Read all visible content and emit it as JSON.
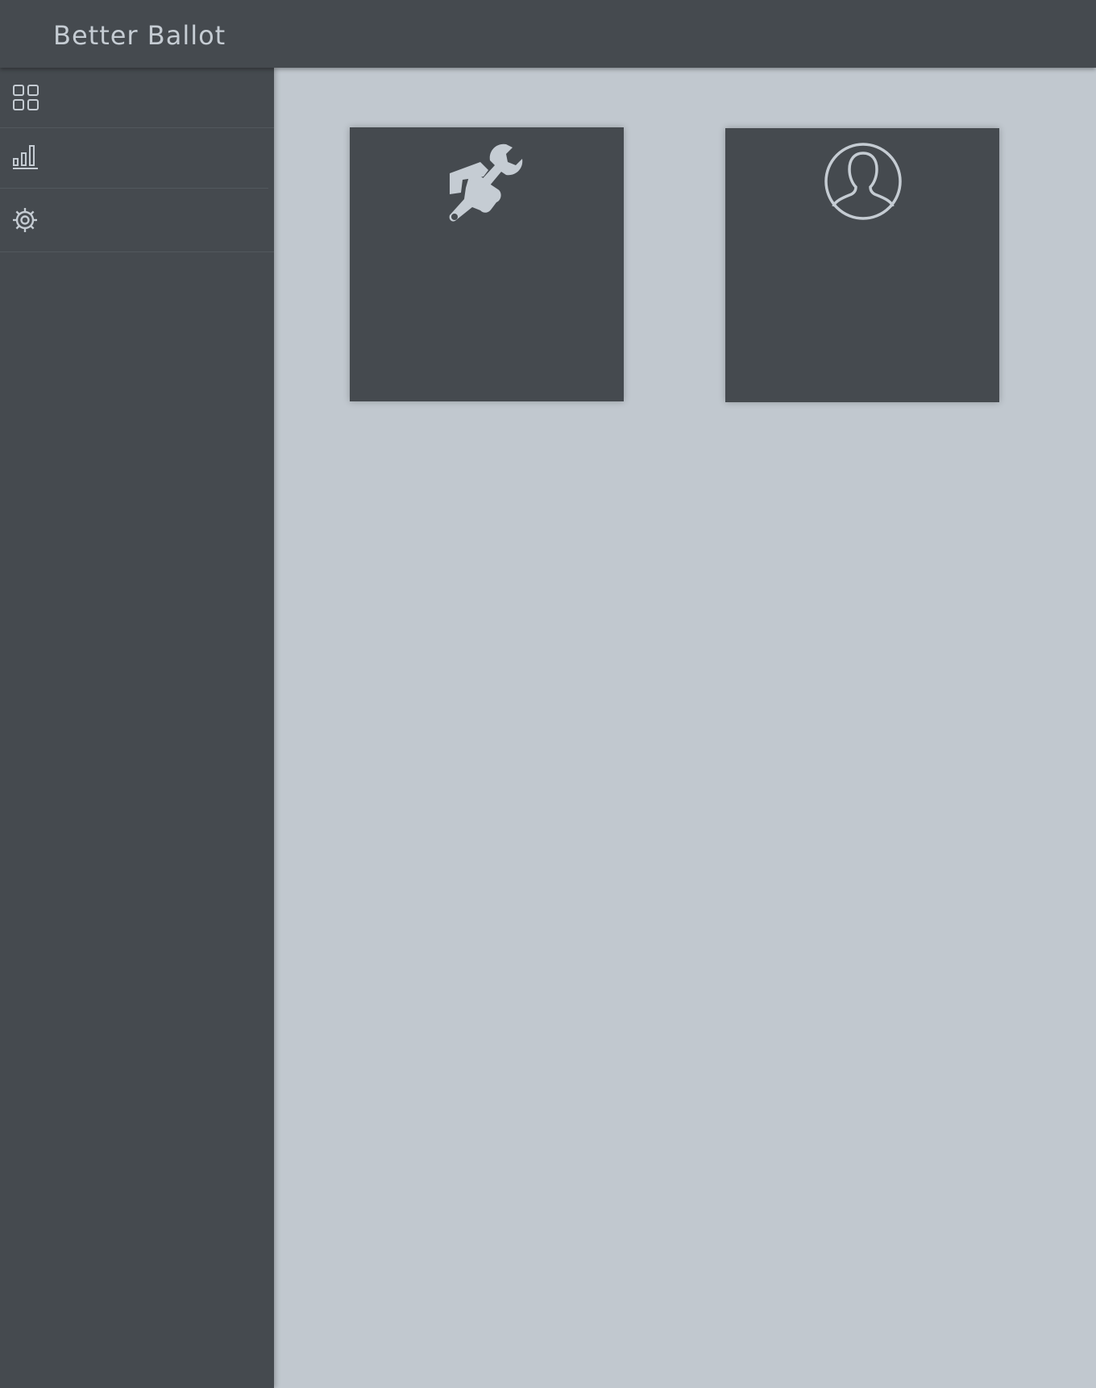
{
  "header": {
    "title": "Better Ballot"
  },
  "sidebar": {
    "items": [
      {
        "name": "dashboard",
        "icon": "grid-icon"
      },
      {
        "name": "statistics",
        "icon": "bar-chart-icon"
      },
      {
        "name": "settings",
        "icon": "gear-icon"
      }
    ]
  },
  "main": {
    "tiles": [
      {
        "name": "admin-tools",
        "icon": "hand-wrench-icon"
      },
      {
        "name": "user-profile",
        "icon": "user-profile-icon"
      }
    ]
  },
  "colors": {
    "topbar": "#454a4f",
    "sidebar": "#454a4f",
    "content_background": "#c1c8cf",
    "tile": "#454a4f",
    "icon": "#c5ccd3"
  }
}
